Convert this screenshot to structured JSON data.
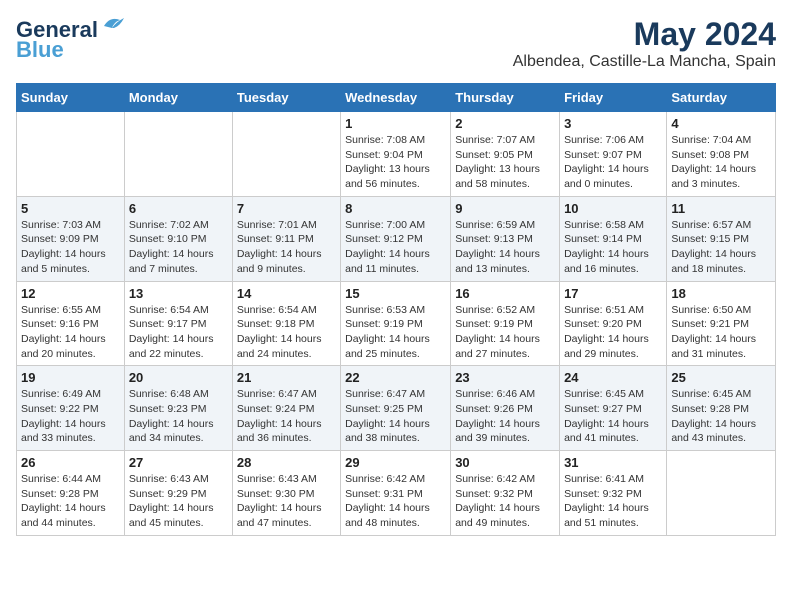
{
  "logo": {
    "line1": "General",
    "line2": "Blue"
  },
  "title": "May 2024",
  "subtitle": "Albendea, Castille-La Mancha, Spain",
  "days_header": [
    "Sunday",
    "Monday",
    "Tuesday",
    "Wednesday",
    "Thursday",
    "Friday",
    "Saturday"
  ],
  "weeks": [
    [
      {
        "day": "",
        "info": ""
      },
      {
        "day": "",
        "info": ""
      },
      {
        "day": "",
        "info": ""
      },
      {
        "day": "1",
        "info": "Sunrise: 7:08 AM\nSunset: 9:04 PM\nDaylight: 13 hours and 56 minutes."
      },
      {
        "day": "2",
        "info": "Sunrise: 7:07 AM\nSunset: 9:05 PM\nDaylight: 13 hours and 58 minutes."
      },
      {
        "day": "3",
        "info": "Sunrise: 7:06 AM\nSunset: 9:07 PM\nDaylight: 14 hours and 0 minutes."
      },
      {
        "day": "4",
        "info": "Sunrise: 7:04 AM\nSunset: 9:08 PM\nDaylight: 14 hours and 3 minutes."
      }
    ],
    [
      {
        "day": "5",
        "info": "Sunrise: 7:03 AM\nSunset: 9:09 PM\nDaylight: 14 hours and 5 minutes."
      },
      {
        "day": "6",
        "info": "Sunrise: 7:02 AM\nSunset: 9:10 PM\nDaylight: 14 hours and 7 minutes."
      },
      {
        "day": "7",
        "info": "Sunrise: 7:01 AM\nSunset: 9:11 PM\nDaylight: 14 hours and 9 minutes."
      },
      {
        "day": "8",
        "info": "Sunrise: 7:00 AM\nSunset: 9:12 PM\nDaylight: 14 hours and 11 minutes."
      },
      {
        "day": "9",
        "info": "Sunrise: 6:59 AM\nSunset: 9:13 PM\nDaylight: 14 hours and 13 minutes."
      },
      {
        "day": "10",
        "info": "Sunrise: 6:58 AM\nSunset: 9:14 PM\nDaylight: 14 hours and 16 minutes."
      },
      {
        "day": "11",
        "info": "Sunrise: 6:57 AM\nSunset: 9:15 PM\nDaylight: 14 hours and 18 minutes."
      }
    ],
    [
      {
        "day": "12",
        "info": "Sunrise: 6:55 AM\nSunset: 9:16 PM\nDaylight: 14 hours and 20 minutes."
      },
      {
        "day": "13",
        "info": "Sunrise: 6:54 AM\nSunset: 9:17 PM\nDaylight: 14 hours and 22 minutes."
      },
      {
        "day": "14",
        "info": "Sunrise: 6:54 AM\nSunset: 9:18 PM\nDaylight: 14 hours and 24 minutes."
      },
      {
        "day": "15",
        "info": "Sunrise: 6:53 AM\nSunset: 9:19 PM\nDaylight: 14 hours and 25 minutes."
      },
      {
        "day": "16",
        "info": "Sunrise: 6:52 AM\nSunset: 9:19 PM\nDaylight: 14 hours and 27 minutes."
      },
      {
        "day": "17",
        "info": "Sunrise: 6:51 AM\nSunset: 9:20 PM\nDaylight: 14 hours and 29 minutes."
      },
      {
        "day": "18",
        "info": "Sunrise: 6:50 AM\nSunset: 9:21 PM\nDaylight: 14 hours and 31 minutes."
      }
    ],
    [
      {
        "day": "19",
        "info": "Sunrise: 6:49 AM\nSunset: 9:22 PM\nDaylight: 14 hours and 33 minutes."
      },
      {
        "day": "20",
        "info": "Sunrise: 6:48 AM\nSunset: 9:23 PM\nDaylight: 14 hours and 34 minutes."
      },
      {
        "day": "21",
        "info": "Sunrise: 6:47 AM\nSunset: 9:24 PM\nDaylight: 14 hours and 36 minutes."
      },
      {
        "day": "22",
        "info": "Sunrise: 6:47 AM\nSunset: 9:25 PM\nDaylight: 14 hours and 38 minutes."
      },
      {
        "day": "23",
        "info": "Sunrise: 6:46 AM\nSunset: 9:26 PM\nDaylight: 14 hours and 39 minutes."
      },
      {
        "day": "24",
        "info": "Sunrise: 6:45 AM\nSunset: 9:27 PM\nDaylight: 14 hours and 41 minutes."
      },
      {
        "day": "25",
        "info": "Sunrise: 6:45 AM\nSunset: 9:28 PM\nDaylight: 14 hours and 43 minutes."
      }
    ],
    [
      {
        "day": "26",
        "info": "Sunrise: 6:44 AM\nSunset: 9:28 PM\nDaylight: 14 hours and 44 minutes."
      },
      {
        "day": "27",
        "info": "Sunrise: 6:43 AM\nSunset: 9:29 PM\nDaylight: 14 hours and 45 minutes."
      },
      {
        "day": "28",
        "info": "Sunrise: 6:43 AM\nSunset: 9:30 PM\nDaylight: 14 hours and 47 minutes."
      },
      {
        "day": "29",
        "info": "Sunrise: 6:42 AM\nSunset: 9:31 PM\nDaylight: 14 hours and 48 minutes."
      },
      {
        "day": "30",
        "info": "Sunrise: 6:42 AM\nSunset: 9:32 PM\nDaylight: 14 hours and 49 minutes."
      },
      {
        "day": "31",
        "info": "Sunrise: 6:41 AM\nSunset: 9:32 PM\nDaylight: 14 hours and 51 minutes."
      },
      {
        "day": "",
        "info": ""
      }
    ]
  ]
}
